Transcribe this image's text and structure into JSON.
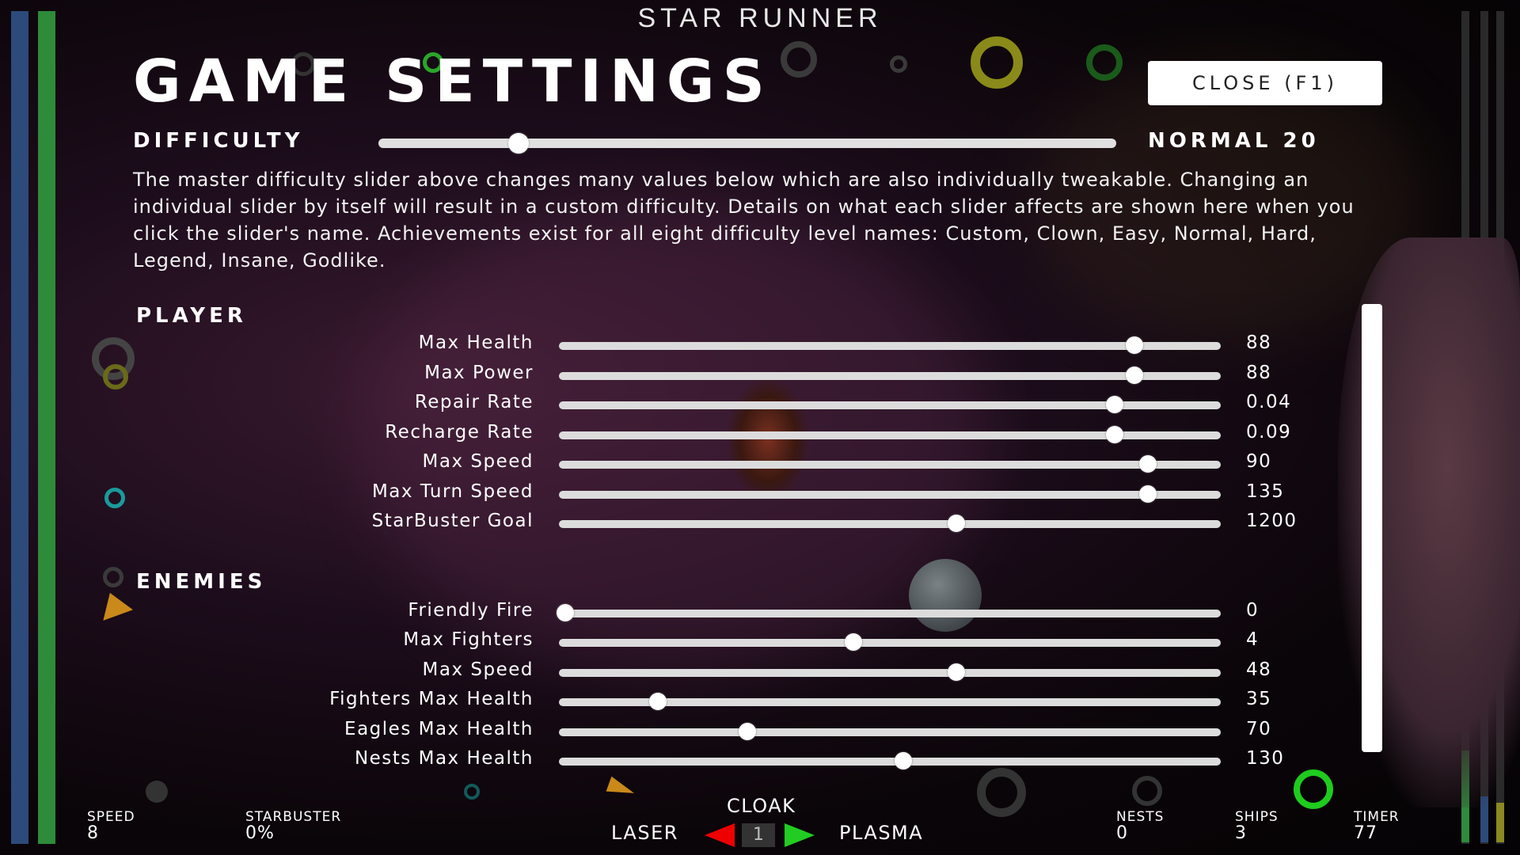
{
  "game_title": "STAR RUNNER",
  "page_title": "GAME SETTINGS",
  "close_button": "CLOSE (F1)",
  "difficulty": {
    "label": "DIFFICULTY",
    "value_text": "NORMAL 20",
    "level": 0.19
  },
  "description": "The master difficulty slider above changes many values below which are also individually tweakable. Changing an individual slider by itself will result in a custom difficulty. Details on what each slider affects are shown here when you click the slider's name. Achievements exist for all eight difficulty level names: Custom, Clown, Easy, Normal, Hard, Legend, Insane, Godlike.",
  "player": {
    "heading": "PLAYER",
    "sliders": [
      {
        "label": "Max Health",
        "value": "88",
        "level": 0.87
      },
      {
        "label": "Max Power",
        "value": "88",
        "level": 0.87
      },
      {
        "label": "Repair Rate",
        "value": "0.04",
        "level": 0.84
      },
      {
        "label": "Recharge Rate",
        "value": "0.09",
        "level": 0.84
      },
      {
        "label": "Max Speed",
        "value": "90",
        "level": 0.89
      },
      {
        "label": "Max Turn Speed",
        "value": "135",
        "level": 0.89
      },
      {
        "label": "StarBuster Goal",
        "value": "1200",
        "level": 0.6
      }
    ]
  },
  "enemies": {
    "heading": "ENEMIES",
    "sliders": [
      {
        "label": "Friendly Fire",
        "value": "0",
        "level": 0.01
      },
      {
        "label": "Max Fighters",
        "value": "4",
        "level": 0.445
      },
      {
        "label": "Max Speed",
        "value": "48",
        "level": 0.6
      },
      {
        "label": "Fighters Max Health",
        "value": "35",
        "level": 0.15
      },
      {
        "label": "Eagles Max Health",
        "value": "70",
        "level": 0.285
      },
      {
        "label": "Nests Max Health",
        "value": "130",
        "level": 0.52
      }
    ]
  },
  "hud": {
    "speed_label": "SPEED",
    "speed": "8",
    "starbuster_label": "STARBUSTER",
    "starbuster": "0%",
    "cloak_label": "CLOAK",
    "laser_label": "LASER",
    "plasma_label": "PLASMA",
    "weapon_slot": "1",
    "nests_label": "NESTS",
    "nests": "0",
    "ships_label": "SHIPS",
    "ships": "3",
    "timer_label": "TIMER",
    "timer": "77"
  },
  "colors": {
    "health_bar": "#2e8b3a",
    "shield_bar": "#2c4a7a",
    "arrow_left": "#ee0000",
    "arrow_right": "#22cc22"
  },
  "icons": {
    "prev_weapon": "arrow-left-icon",
    "next_weapon": "arrow-right-icon"
  }
}
